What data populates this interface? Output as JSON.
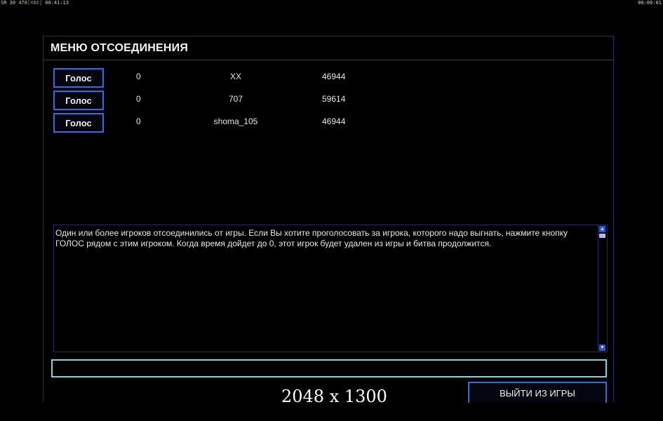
{
  "hud": {
    "left": {
      "a": "SR",
      "b": "30",
      "c": "478",
      "d": "[486]",
      "time": "00:41:13"
    },
    "right": {
      "time": "00:00:01"
    }
  },
  "dialog": {
    "title": "МЕНЮ ОТСОЕДИНЕНИЯ",
    "players": [
      {
        "vote_label": "Голос",
        "count": "0",
        "name": "XX",
        "value": "46944"
      },
      {
        "vote_label": "Голос",
        "count": "0",
        "name": "707",
        "value": "59614"
      },
      {
        "vote_label": "Голос",
        "count": "0",
        "name": "shoma_105",
        "value": "46944"
      }
    ],
    "message": "Один или более игроков отсоединились от игры. Если Вы хотите проголосовать за игрока, которого надо выгнать, нажмите кнопку  ГОЛОС рядом с этим игроком. Когда время дойдет до 0, этот игрок будет удален из игры и битва продолжится.",
    "chat_input": {
      "value": "",
      "placeholder": ""
    },
    "exit_label": "ВЫЙТИ ИЗ ИГРЫ"
  },
  "overlay": {
    "resolution_text": "2048 x 1300"
  },
  "icons": {
    "scroll_up": "scroll-up-arrow-icon",
    "scroll_down": "scroll-down-arrow-icon"
  }
}
